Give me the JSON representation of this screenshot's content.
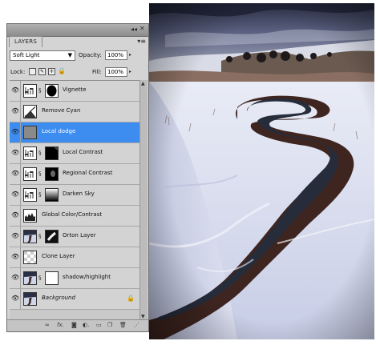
{
  "panel": {
    "tab_label": "LAYERS",
    "blend_mode": "Soft Light",
    "opacity_label": "Opacity:",
    "opacity_value": "100%",
    "lock_label": "Lock:",
    "fill_label": "Fill:",
    "fill_value": "100%"
  },
  "layers": [
    {
      "name": "Vignette",
      "thumb": "levels-icon",
      "mask": "vignette-mask",
      "selected": false
    },
    {
      "name": "Remove Cyan",
      "thumb": "curves-icon",
      "mask": "",
      "selected": false
    },
    {
      "name": "Local dodge",
      "thumb": "gray-fill",
      "mask": "",
      "selected": true
    },
    {
      "name": "Local Contrast",
      "thumb": "levels-icon",
      "mask": "dark-mask",
      "selected": false
    },
    {
      "name": "Regional Contrast",
      "thumb": "levels-icon",
      "mask": "dark-spot-mask",
      "selected": false
    },
    {
      "name": "Darken Sky",
      "thumb": "levels-icon",
      "mask": "gradient-mask",
      "selected": false
    },
    {
      "name": "Global Color/Contrast",
      "thumb": "histogram-icon",
      "mask": "",
      "selected": false
    },
    {
      "name": "Orton Layer",
      "thumb": "photo-thumb",
      "mask": "orton-mask",
      "selected": false
    },
    {
      "name": "Clone Layer",
      "thumb": "transparent-thumb",
      "mask": "",
      "selected": false
    },
    {
      "name": "shadow/highlight",
      "thumb": "photo-thumb",
      "mask": "white-mask",
      "selected": false
    },
    {
      "name": "Background",
      "thumb": "photo-thumb",
      "mask": "",
      "selected": false,
      "locked": true
    }
  ],
  "colors": {
    "selected_row": "#3d8cf0",
    "panel_bg": "#d4d4d4"
  }
}
